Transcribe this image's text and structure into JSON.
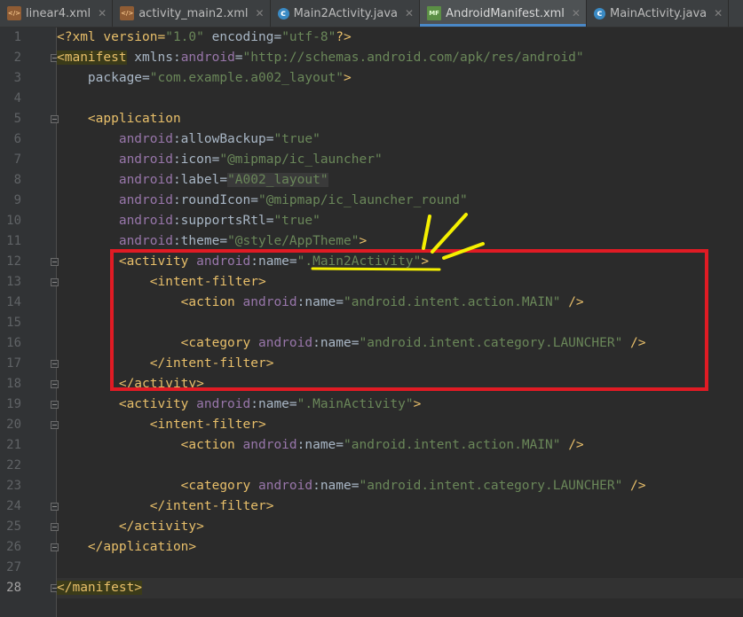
{
  "tabs": [
    {
      "label": "linear4.xml",
      "icon": "xml-file-icon",
      "active": false
    },
    {
      "label": "activity_main2.xml",
      "icon": "xml-file-icon",
      "active": false
    },
    {
      "label": "Main2Activity.java",
      "icon": "java-class-icon",
      "active": false
    },
    {
      "label": "AndroidManifest.xml",
      "icon": "manifest-file-icon",
      "active": true
    },
    {
      "label": "MainActivity.java",
      "icon": "java-class-icon",
      "active": false
    }
  ],
  "editor": {
    "current_line": 28,
    "line_numbers": [
      "1",
      "2",
      "3",
      "4",
      "5",
      "6",
      "7",
      "8",
      "9",
      "10",
      "11",
      "12",
      "13",
      "14",
      "15",
      "16",
      "17",
      "18",
      "19",
      "20",
      "21",
      "22",
      "23",
      "24",
      "25",
      "26",
      "27",
      "28"
    ],
    "code": {
      "l1a": "<?xml version=",
      "l1b": "\"1.0\"",
      "l1c": " encoding=",
      "l1d": "\"utf-8\"",
      "l1e": "?>",
      "l2a": "<manifest",
      "l2b": " xmlns:",
      "l2c": "android",
      "l2d": "=",
      "l2e": "\"http://schemas.android.com/apk/res/android\"",
      "l3a": "    package=",
      "l3b": "\"com.example.a002_layout\"",
      "l3c": ">",
      "l5a": "    <application",
      "l6a": "        android",
      "l6b": ":allowBackup=",
      "l6c": "\"true\"",
      "l7a": "        android",
      "l7b": ":icon=",
      "l7c": "\"@mipmap/ic_launcher\"",
      "l8a": "        android",
      "l8b": ":label=",
      "l8c": "\"A002_layout\"",
      "l9a": "        android",
      "l9b": ":roundIcon=",
      "l9c": "\"@mipmap/ic_launcher_round\"",
      "l10a": "        android",
      "l10b": ":supportsRtl=",
      "l10c": "\"true\"",
      "l11a": "        android",
      "l11b": ":theme=",
      "l11c": "\"@style/AppTheme\"",
      "l11d": ">",
      "l12a": "        <activity",
      "l12b": " android",
      "l12c": ":name=",
      "l12d": "\".Main2Activity\"",
      "l12e": ">",
      "l13a": "            <intent-filter>",
      "l14a": "                <action",
      "l14b": " android",
      "l14c": ":name=",
      "l14d": "\"android.intent.action.MAIN\"",
      "l14e": " />",
      "l16a": "                <category",
      "l16b": " android",
      "l16c": ":name=",
      "l16d": "\"android.intent.category.LAUNCHER\"",
      "l16e": " />",
      "l17a": "            </intent-filter>",
      "l18a": "        </activity>",
      "l19a": "        <activity",
      "l19b": " android",
      "l19c": ":name=",
      "l19d": "\".MainActivity\"",
      "l19e": ">",
      "l20a": "            <intent-filter>",
      "l21a": "                <action",
      "l21b": " android",
      "l21c": ":name=",
      "l21d": "\"android.intent.action.MAIN\"",
      "l21e": " />",
      "l23a": "                <category",
      "l23b": " android",
      "l23c": ":name=",
      "l23d": "\"android.intent.category.LAUNCHER\"",
      "l23e": " />",
      "l24a": "            </intent-filter>",
      "l25a": "        </activity>",
      "l26a": "    </application>",
      "l28a": "</manifest>"
    }
  },
  "colors": {
    "background": "#2b2b2b",
    "tag": "#e8bf6a",
    "namespace": "#9876aa",
    "value": "#6a8759",
    "annotation_red": "#e01b24",
    "annotation_yellow": "#f5f000"
  }
}
